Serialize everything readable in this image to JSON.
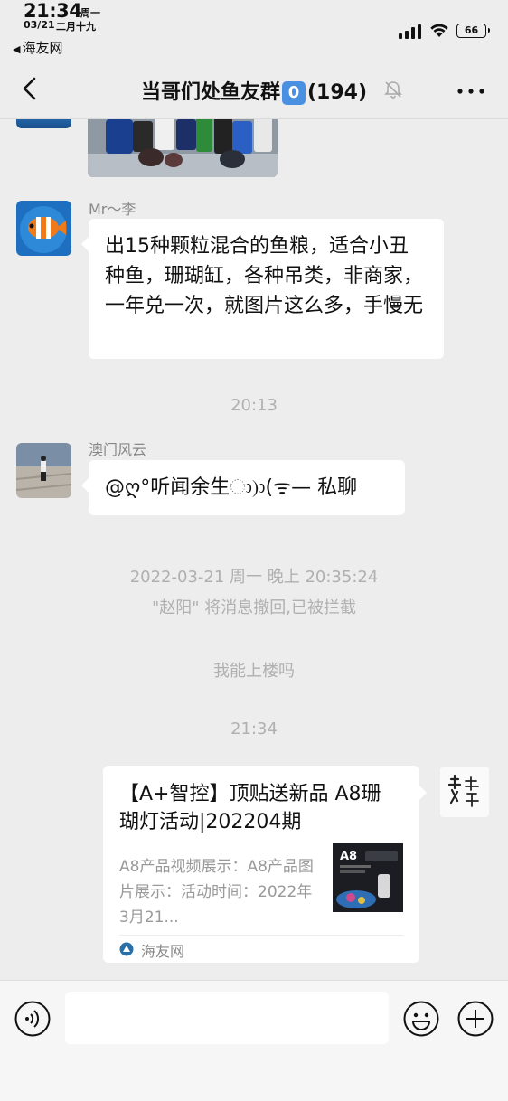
{
  "status_bar": {
    "time": "21:34",
    "weekday": "周一",
    "date": "03/21",
    "lunar": "二月十九",
    "battery": "66",
    "back_app_label": "海友网"
  },
  "nav": {
    "group_name": "当哥们处鱼友群",
    "badge": "0",
    "member_count": "(194)"
  },
  "messages": {
    "msg1": {
      "sender": "Mr～李",
      "text": "出15种颗粒混合的鱼粮，适合小丑种鱼，珊瑚缸，各种吊类，非商家，一年兑一次，就图片这么多，手慢无"
    },
    "time1": "20:13",
    "msg2": {
      "sender": "澳门风云",
      "text": "@ღ°听闻余生ා)ා(ᯤ— 私聊"
    },
    "recall_time": "2022-03-21 周一 晚上 20:35:24",
    "recall_notice": "\"赵阳\" 将消息撤回,已被拦截",
    "system_note": "我能上楼吗",
    "time2": "21:34",
    "card": {
      "title": "【A+智控】顶贴送新品 A8珊 瑚灯活动|202204期",
      "description": "A8产品视频展示：A8产品图片展示：活动时间：2022年3月21...",
      "thumb_label": "A8",
      "source": "海友网"
    }
  },
  "input_bar": {
    "placeholder": ""
  },
  "colors": {
    "background": "#ededed",
    "bubble": "#ffffff",
    "badge": "#4a90e2",
    "secondary_text": "#888888"
  }
}
